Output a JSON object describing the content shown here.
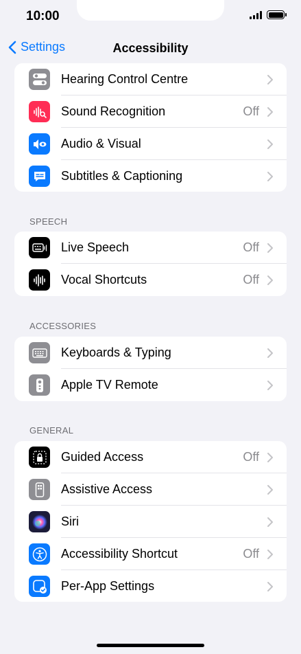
{
  "status_bar": {
    "time": "10:00"
  },
  "nav": {
    "back_label": "Settings",
    "title": "Accessibility"
  },
  "groups": [
    {
      "header": "",
      "items": [
        {
          "label": "Hearing Control Centre",
          "value": "",
          "icon": "hearing-control-icon",
          "color": "#8e8e93"
        },
        {
          "label": "Sound Recognition",
          "value": "Off",
          "icon": "sound-recognition-icon",
          "color": "#ff2d55"
        },
        {
          "label": "Audio & Visual",
          "value": "",
          "icon": "audio-visual-icon",
          "color": "#0a7aff"
        },
        {
          "label": "Subtitles & Captioning",
          "value": "",
          "icon": "subtitles-icon",
          "color": "#0a7aff"
        }
      ]
    },
    {
      "header": "SPEECH",
      "items": [
        {
          "label": "Live Speech",
          "value": "Off",
          "icon": "live-speech-icon",
          "color": "#000000"
        },
        {
          "label": "Vocal Shortcuts",
          "value": "Off",
          "icon": "vocal-shortcuts-icon",
          "color": "#000000"
        }
      ]
    },
    {
      "header": "ACCESSORIES",
      "items": [
        {
          "label": "Keyboards & Typing",
          "value": "",
          "icon": "keyboard-icon",
          "color": "#8e8e93"
        },
        {
          "label": "Apple TV Remote",
          "value": "",
          "icon": "tv-remote-icon",
          "color": "#8e8e93"
        }
      ]
    },
    {
      "header": "GENERAL",
      "items": [
        {
          "label": "Guided Access",
          "value": "Off",
          "icon": "guided-access-icon",
          "color": "#000000"
        },
        {
          "label": "Assistive Access",
          "value": "",
          "icon": "assistive-access-icon",
          "color": "#8e8e93"
        },
        {
          "label": "Siri",
          "value": "",
          "icon": "siri-icon",
          "color": "#1c1c3a"
        },
        {
          "label": "Accessibility Shortcut",
          "value": "Off",
          "icon": "accessibility-shortcut-icon",
          "color": "#0a7aff"
        },
        {
          "label": "Per-App Settings",
          "value": "",
          "icon": "per-app-settings-icon",
          "color": "#0a7aff"
        }
      ]
    }
  ]
}
